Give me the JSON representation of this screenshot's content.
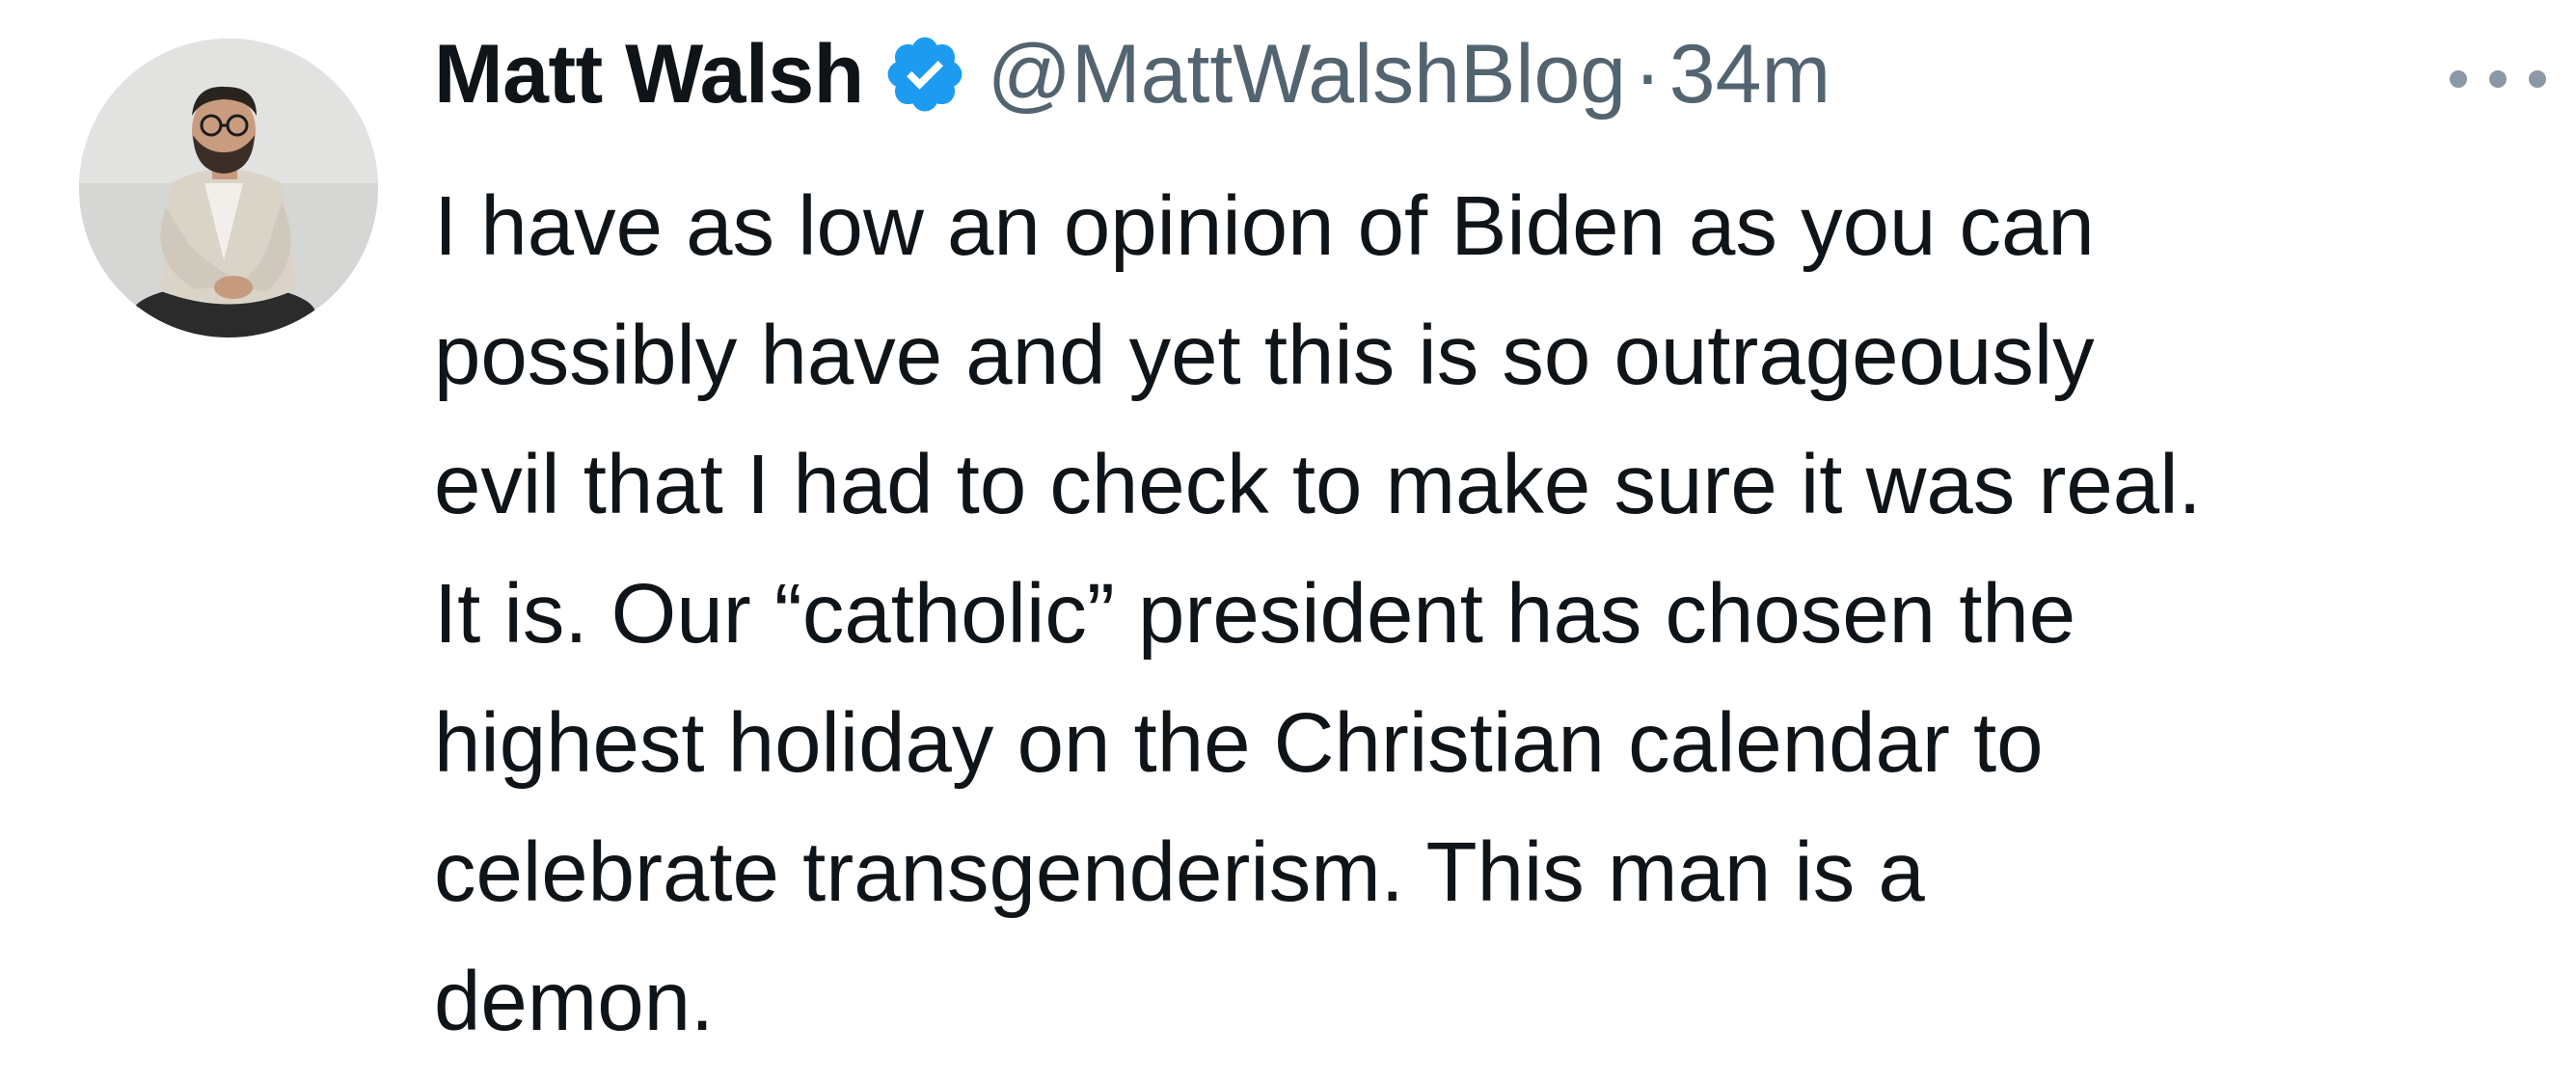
{
  "author": {
    "display_name": "Matt Walsh",
    "handle": "@MattWalshBlog",
    "separator": "·",
    "timestamp": "34m",
    "verified_icon": "verified-badge-icon",
    "verified_color": "#1d9bf0"
  },
  "more_icon": "more-horizontal-icon",
  "tweet": {
    "lines": [
      "I have as low an opinion of Biden as you can",
      "possibly have and yet this is so outrageously",
      "evil that I had to check to make sure it was real.",
      "It is. Our “catholic” president has chosen the",
      "highest holiday on the Christian calendar to",
      "celebrate transgenderism. This man is a",
      "demon."
    ]
  },
  "colors": {
    "text_primary": "#0f1419",
    "text_secondary": "#536471",
    "background": "#ffffff"
  }
}
